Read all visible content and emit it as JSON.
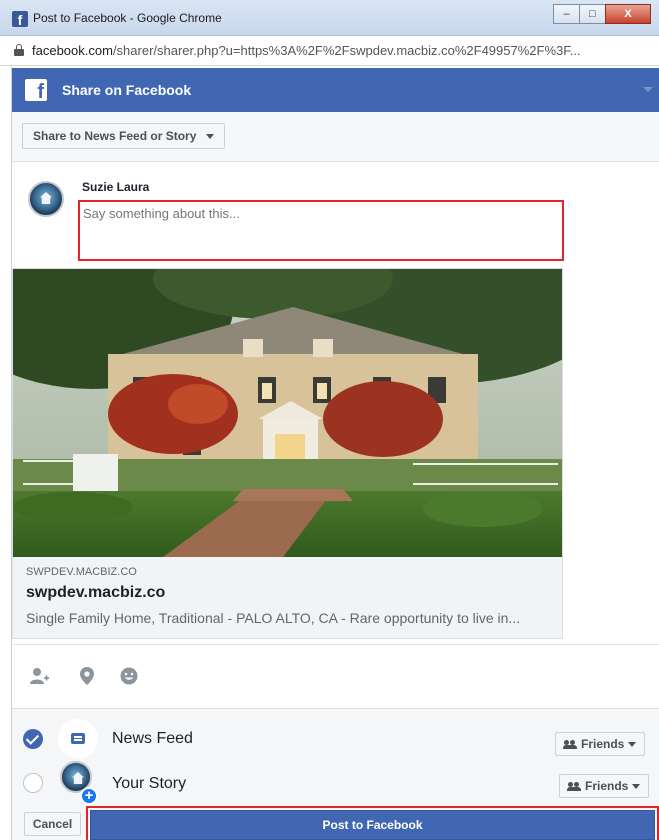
{
  "window": {
    "title": "Post to Facebook - Google Chrome",
    "minimize": "–",
    "maximize": "□",
    "close": "X"
  },
  "address_bar": {
    "host": "facebook.com",
    "path": "/sharer/sharer.php?u=https%3A%2F%2Fswpdev.macbiz.co%2F49957%2F%3F..."
  },
  "header": {
    "logo": "f",
    "title": "Share on Facebook"
  },
  "share_dropdown": {
    "label": "Share to News Feed or Story"
  },
  "composer": {
    "author": "Suzie Laura",
    "placeholder": "Say something about this..."
  },
  "preview": {
    "domain": "SWPDEV.MACBIZ.CO",
    "title": "swpdev.macbiz.co",
    "description": "Single Family Home, Traditional - PALO ALTO, CA - Rare opportunity to live in..."
  },
  "actions": {
    "icons": [
      "tag-friends-icon",
      "location-icon",
      "feeling-icon"
    ]
  },
  "destinations": [
    {
      "label": "News Feed",
      "checked": true,
      "audience": "Friends"
    },
    {
      "label": "Your Story",
      "checked": false,
      "audience": "Friends"
    }
  ],
  "buttons": {
    "cancel": "Cancel",
    "post": "Post to Facebook"
  },
  "colors": {
    "facebook_blue": "#4267b2",
    "highlight_red": "#e2252b"
  }
}
